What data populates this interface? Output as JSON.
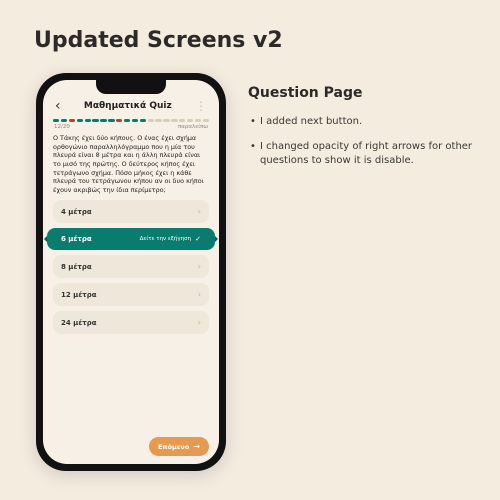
{
  "page": {
    "title": "Updated Screens v2"
  },
  "phone": {
    "header": {
      "title": "Μαθηματικά Quiz"
    },
    "sub": {
      "counter": "12/20",
      "skip": "παραλείπω"
    },
    "question": "Ο Τάκης έχει δύο κήπους. Ο ένας έχει σχήμα ορθογώνιο παραλληλόγραμμο που η μία του πλευρά είναι 8 μέτρα και η άλλη πλευρά είναι το μισό της πρώτης. Ο δεύτερος κήπος έχει τετράγωνο σχήμα. Πόσο μήκος έχει η κάθε πλευρά του τετράγωνου κήπου αν οι δυο κήποι έχουν ακριβώς την ίδια περίμετρο;",
    "options": [
      {
        "label": "4 μέτρα"
      },
      {
        "label": "6 μέτρα",
        "selected_hint": "Δείτε την εξήγηση"
      },
      {
        "label": "8 μέτρα"
      },
      {
        "label": "12 μέτρα"
      },
      {
        "label": "24 μέτρα"
      }
    ],
    "next_label": "Επόμενο"
  },
  "side": {
    "title": "Question Page",
    "bullets": [
      "I added next button.",
      "I changed opacity of right arrows for other questions to show it is disable."
    ]
  }
}
